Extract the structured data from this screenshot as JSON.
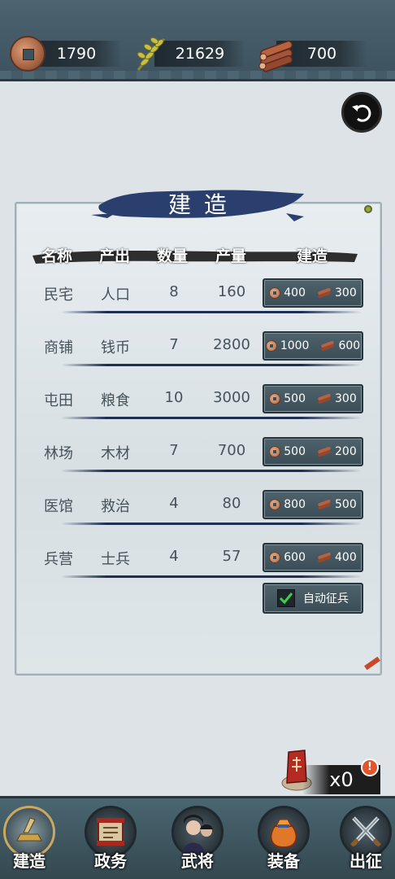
{
  "resources": {
    "copper": "1790",
    "grain": "21629",
    "wood": "700"
  },
  "panel": {
    "title": "建造",
    "headers": [
      "名称",
      "产出",
      "数量",
      "产量",
      "建造"
    ],
    "rows": [
      {
        "name": "民宅",
        "output": "人口",
        "count": "8",
        "yield": "160",
        "cost_coin": "400",
        "cost_wood": "300"
      },
      {
        "name": "商铺",
        "output": "钱币",
        "count": "7",
        "yield": "2800",
        "cost_coin": "1000",
        "cost_wood": "600"
      },
      {
        "name": "屯田",
        "output": "粮食",
        "count": "10",
        "yield": "3000",
        "cost_coin": "500",
        "cost_wood": "300"
      },
      {
        "name": "林场",
        "output": "木材",
        "count": "7",
        "yield": "700",
        "cost_coin": "500",
        "cost_wood": "200"
      },
      {
        "name": "医馆",
        "output": "救治",
        "count": "4",
        "yield": "80",
        "cost_coin": "800",
        "cost_wood": "500"
      },
      {
        "name": "兵营",
        "output": "士兵",
        "count": "4",
        "yield": "57",
        "cost_coin": "600",
        "cost_wood": "400"
      }
    ],
    "auto_recruit_label": "自动征兵",
    "auto_recruit_checked": true
  },
  "token": {
    "count": "x0",
    "alert": "!"
  },
  "nav": [
    {
      "label": "建造",
      "active": true
    },
    {
      "label": "政务",
      "active": false
    },
    {
      "label": "武将",
      "active": false
    },
    {
      "label": "装备",
      "active": false
    },
    {
      "label": "出征",
      "active": false
    }
  ],
  "colors": {
    "panel_bg": "#e0e6e9",
    "button_bg": "#3b4d56",
    "ink": "#1f2e54",
    "check_green": "#3ecf4a"
  }
}
